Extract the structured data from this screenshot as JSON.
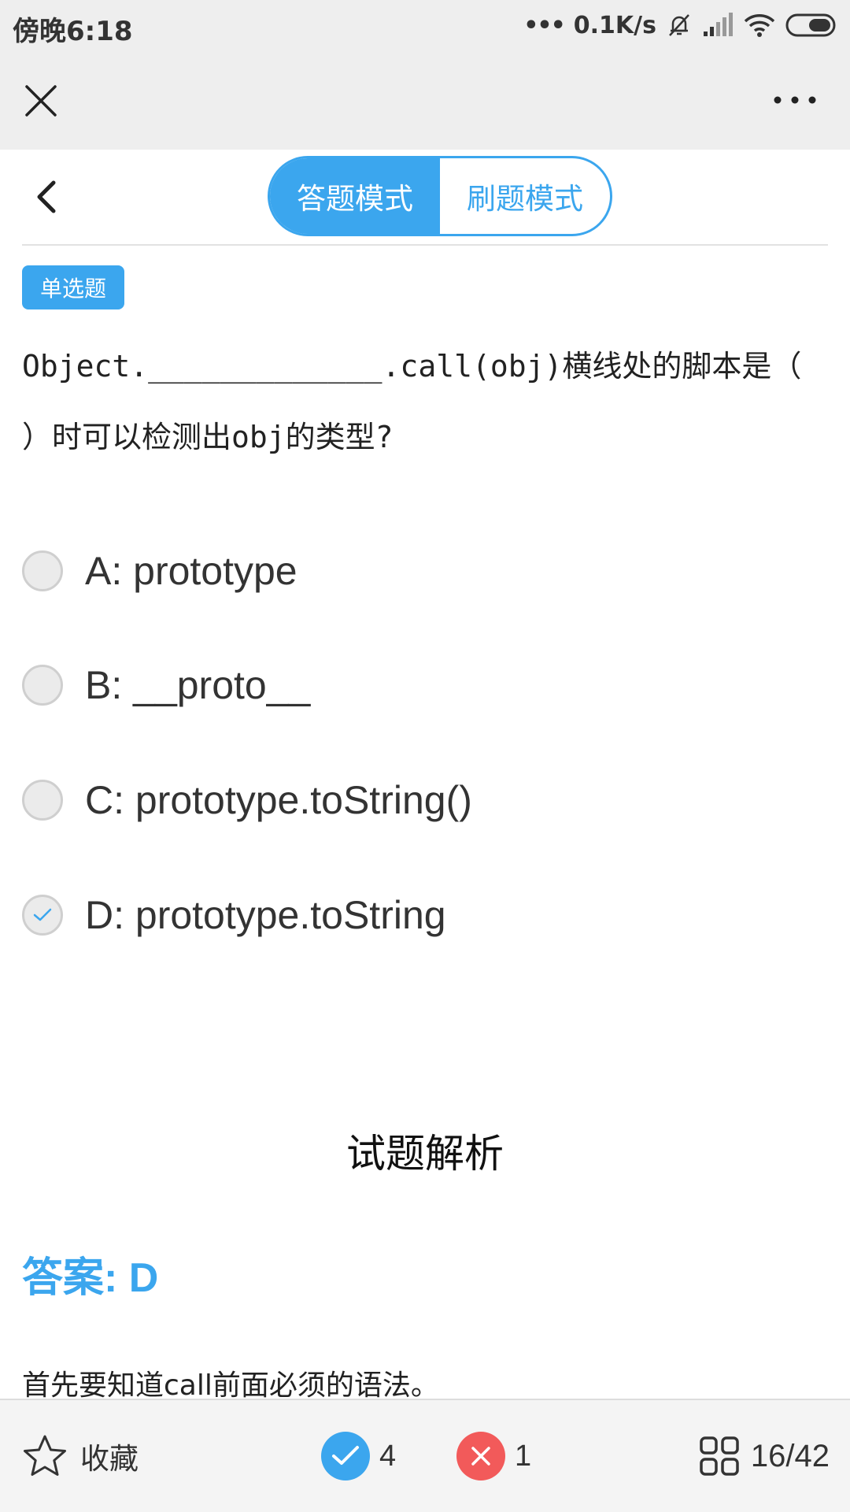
{
  "status_bar": {
    "time": "傍晚6:18",
    "dots": "•••",
    "network_speed": "0.1K/s"
  },
  "title_bar": {
    "close_icon": "close-icon",
    "more_icon": "more-icon"
  },
  "nav": {
    "back_icon": "chevron-left-icon",
    "modes": [
      {
        "label": "答题模式",
        "active": true
      },
      {
        "label": "刷题模式",
        "active": false
      }
    ]
  },
  "question": {
    "type_label": "单选题",
    "text": "Object._____________.call(obj)横线处的脚本是（   ）时可以检测出obj的类型?",
    "options": [
      {
        "text": "A: prototype",
        "selected": false
      },
      {
        "text": "B: __proto__",
        "selected": false
      },
      {
        "text": "C: prototype.toString()",
        "selected": false
      },
      {
        "text": "D: prototype.toString",
        "selected": true
      }
    ]
  },
  "analysis": {
    "title": "试题解析",
    "answer_label": "答案: D",
    "explanation": "首先要知道call前面必须的语法。"
  },
  "bottom_bar": {
    "favorite_label": "收藏",
    "correct_count": "4",
    "wrong_count": "1",
    "progress": "16/42"
  },
  "colors": {
    "accent": "#3ba6ee",
    "wrong": "#f25a5a",
    "status_bg": "#eeeeee"
  }
}
